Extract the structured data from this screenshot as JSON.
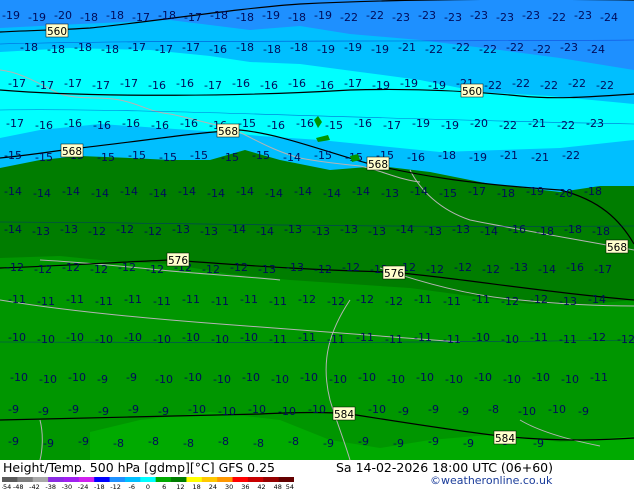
{
  "map": {
    "colors": {
      "band_blue": "#1e90ff",
      "band_lightblue": "#00bfff",
      "band_cyan": "#00ffff",
      "band_darkgreen": "#007d00",
      "band_green": "#009600",
      "band_lightgreen": "#00aa00",
      "contour_height": "#000000",
      "contour_temp": "#0000b4",
      "coast": "#b4b4b4"
    },
    "height_labels": [
      "560",
      "560",
      "568",
      "568",
      "568",
      "576",
      "576",
      "584",
      "584",
      "568"
    ],
    "temp_rows": [
      {
        "items": [
          "-19",
          "-19",
          "-20",
          "-18",
          "-18",
          "-17",
          "-18",
          "-17",
          "-18",
          "-18",
          "-19",
          "-18",
          "-19",
          "-22",
          "-22",
          "-23",
          "-23",
          "-23",
          "-23",
          "-23",
          "-23",
          "-22",
          "-23",
          "-24"
        ]
      },
      {
        "items": [
          "-18",
          "-18",
          "-18",
          "-18",
          "-17",
          "-17",
          "-17",
          "-16",
          "-18",
          "-18",
          "-18",
          "-19",
          "-19",
          "-19",
          "-21",
          "-22",
          "-22",
          "-22",
          "-22",
          "-22",
          "-23",
          "-24"
        ]
      },
      {
        "items": [
          "-17",
          "-17",
          "-17",
          "-17",
          "-17",
          "-16",
          "-16",
          "-17",
          "-16",
          "-16",
          "-16",
          "-16",
          "-17",
          "-19",
          "-19",
          "-19",
          "-21",
          "-22",
          "-22",
          "-22",
          "-22",
          "-22"
        ]
      },
      {
        "items": [
          "-17",
          "-16",
          "-16",
          "-16",
          "-16",
          "-16",
          "-16",
          "-16",
          "-15",
          "-16",
          "-16",
          "-15",
          "-16",
          "-17",
          "-19",
          "-19",
          "-20",
          "-22",
          "-21",
          "-22",
          "-23"
        ]
      },
      {
        "items": [
          "-15",
          "-15",
          "-15",
          "-15",
          "-15",
          "-15",
          "-15",
          "-15",
          "-15",
          "-14",
          "-15",
          "-15",
          "-15",
          "-16",
          "-18",
          "-19",
          "-21",
          "-21",
          "-22"
        ]
      },
      {
        "items": [
          "-14",
          "-14",
          "-14",
          "-14",
          "-14",
          "-14",
          "-14",
          "-14",
          "-14",
          "-14",
          "-14",
          "-14",
          "-14",
          "-13",
          "-14",
          "-15",
          "-17",
          "-18",
          "-19",
          "-20",
          "-18"
        ]
      },
      {
        "items": [
          "-14",
          "-13",
          "-13",
          "-12",
          "-12",
          "-12",
          "-13",
          "-13",
          "-14",
          "-14",
          "-13",
          "-13",
          "-13",
          "-13",
          "-14",
          "-13",
          "-13",
          "-14",
          "-16",
          "-18",
          "-18",
          "-18"
        ]
      },
      {
        "items": [
          "-12",
          "-12",
          "-12",
          "-12",
          "-12",
          "-12",
          "-12",
          "-12",
          "-12",
          "-13",
          "-13",
          "-12",
          "-12",
          "-12",
          "-12",
          "-12",
          "-12",
          "-12",
          "-13",
          "-14",
          "-16",
          "-17"
        ]
      },
      {
        "items": [
          "-11",
          "-11",
          "-11",
          "-11",
          "-11",
          "-11",
          "-11",
          "-11",
          "-11",
          "-11",
          "-12",
          "-12",
          "-12",
          "-12",
          "-11",
          "-11",
          "-11",
          "-12",
          "-12",
          "-13",
          "-14"
        ]
      },
      {
        "items": [
          "-10",
          "-10",
          "-10",
          "-10",
          "-10",
          "-10",
          "-10",
          "-10",
          "-10",
          "-11",
          "-11",
          "-11",
          "-11",
          "-11",
          "-11",
          "-11",
          "-10",
          "-10",
          "-11",
          "-11",
          "-12",
          "-12"
        ]
      },
      {
        "items": [
          "-10",
          "-10",
          "-10",
          "-9",
          "-9",
          "-10",
          "-10",
          "-10",
          "-10",
          "-10",
          "-10",
          "-10",
          "-10",
          "-10",
          "-10",
          "-10",
          "-10",
          "-10",
          "-10",
          "-10",
          "-11"
        ]
      },
      {
        "items": [
          "-9",
          "-9",
          "-9",
          "-9",
          "-9",
          "-9",
          "-10",
          "-10",
          "-10",
          "-10",
          "-10",
          "-10",
          "-10",
          "-9",
          "-9",
          "-9",
          "-8",
          "-10",
          "-10",
          "-9"
        ]
      },
      {
        "items": [
          "-9",
          "-9",
          "-9",
          "-8",
          "-8",
          "-8",
          "-8",
          "-8",
          "-8",
          "-9",
          "-9",
          "-9",
          "-9",
          "-9",
          "-9",
          "-9"
        ]
      }
    ]
  },
  "footer": {
    "title": "Height/Temp. 500 hPa [gdmp][°C] GFS 0.25",
    "date": "Sa 14-02-2026 18:00 UTC (06+60)",
    "credit": "©weatheronline.co.uk",
    "scale_ticks": [
      "-54",
      "-48",
      "-42",
      "-38",
      "-30",
      "-24",
      "-18",
      "-12",
      "-6",
      "0",
      "6",
      "12",
      "18",
      "24",
      "30",
      "36",
      "42",
      "48",
      "54"
    ],
    "scale_colors": [
      "#5a5a5a",
      "#7f7f7f",
      "#a8a8a8",
      "#8a2be2",
      "#a020f0",
      "#d020f0",
      "#0000ff",
      "#1e90ff",
      "#00bfff",
      "#00ffff",
      "#00aa00",
      "#007d00",
      "#ffff00",
      "#ffc800",
      "#ff9600",
      "#ff0000",
      "#c80000",
      "#960000",
      "#640000"
    ]
  }
}
